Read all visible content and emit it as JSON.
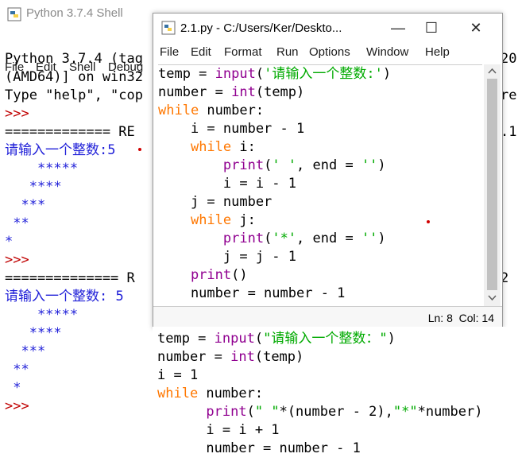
{
  "shell": {
    "title": "Python 3.7.4 Shell",
    "menu": [
      "File",
      "Edit",
      "Shell",
      "Debug"
    ],
    "lines": [
      {
        "text": "Python 3.7.4 (tag",
        "cls": ""
      },
      {
        "text": "(AMD64)] on win32",
        "cls": ""
      },
      {
        "text": "Type \"help\", \"cop",
        "cls": ""
      },
      {
        "text": ">>>",
        "cls": "red"
      },
      {
        "text": "============= RE",
        "cls": ""
      },
      {
        "text": "请输入一个整数:5",
        "cls": "blue"
      },
      {
        "text": "    *****",
        "cls": "blue"
      },
      {
        "text": "   ****",
        "cls": "blue"
      },
      {
        "text": "  ***",
        "cls": "blue"
      },
      {
        "text": " **",
        "cls": "blue"
      },
      {
        "text": "*",
        "cls": "blue"
      },
      {
        "text": ">>>",
        "cls": "red"
      },
      {
        "text": "============== R",
        "cls": ""
      },
      {
        "text": "请输入一个整数: 5",
        "cls": "blue"
      },
      {
        "text": "    *****",
        "cls": "blue"
      },
      {
        "text": "   ****",
        "cls": "blue"
      },
      {
        "text": "  ***",
        "cls": "blue"
      },
      {
        "text": " **",
        "cls": "blue"
      },
      {
        "text": " *",
        "cls": "blue"
      },
      {
        "text": ">>>",
        "cls": "red"
      }
    ],
    "right_fragments": [
      "20",
      "",
      "re",
      "",
      ".1",
      "",
      "",
      "",
      "",
      "",
      "",
      "",
      "2"
    ]
  },
  "editor": {
    "title": "2.1.py - C:/Users/Ker/Deskto...",
    "minimize": "—",
    "maximize": "☐",
    "close": "✕",
    "menu": [
      "File",
      "Edit",
      "Format",
      "Run",
      "Options",
      "Window",
      "Help"
    ],
    "status": "Ln: 8  Col: 14"
  },
  "code_top": [
    "temp = input('请输入一个整数:')",
    "number = int(temp)",
    "while number:",
    "    i = number - 1",
    "    while i:",
    "        print(' ', end = '')",
    "        i = i - 1",
    "    j = number",
    "    while j:",
    "        print('*', end = '')",
    "        j = j - 1",
    "    print()",
    "    number = number - 1"
  ],
  "code_bottom": [
    "temp = input(\"请输入一个整数：\")",
    "number = int(temp)",
    "i = 1",
    "while number:",
    "      print(\" \"*(number - 2),\"*\"*number)",
    "      i = i + 1",
    "      number = number - 1"
  ]
}
